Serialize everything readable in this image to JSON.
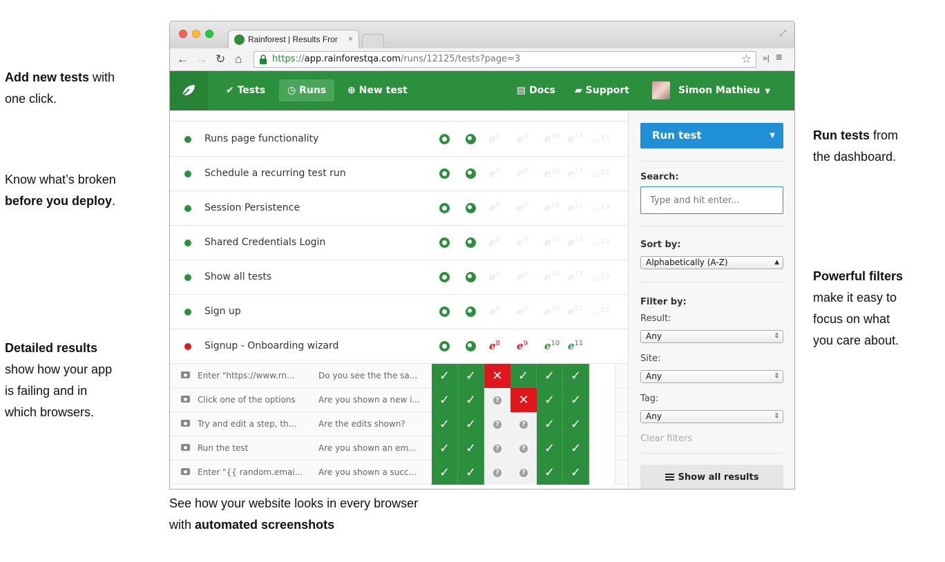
{
  "notes": {
    "left1_bold": "Add new tests",
    "left1_rest": " with",
    "left1_line2": "one click.",
    "left2_line1": "Know what’s broken",
    "left2_bold": "before you deploy",
    "left2_end": ".",
    "left3_bold": "Detailed results",
    "left3_line2": "show how your app",
    "left3_line3": "is failing and in",
    "left3_line4": "which browsers.",
    "right1_bold": "Run tests",
    "right1_rest": " from",
    "right1_line2": "the dashboard.",
    "right2_bold": "Powerful filters",
    "right2_line2": "make it easy to",
    "right2_line3": "focus on what",
    "right2_line4": "you care about.",
    "bottom_line1": "See how your website looks in every browser",
    "bottom_pre": "with ",
    "bottom_bold": "automated screenshots"
  },
  "browser": {
    "tab_title": "Rainforest | Results From R",
    "tab_close": "×",
    "url_scheme": "https",
    "url_sep": "://",
    "url_host": "app.rainforestqa.com",
    "url_path": "/runs/12125/tests?page=3",
    "ext_label": "»|",
    "menu_glyph": "≡"
  },
  "nav": {
    "tests": "Tests",
    "runs": "Runs",
    "new_test": "New test",
    "docs": "Docs",
    "support": "Support",
    "user": "Simon Mathieu"
  },
  "tests": [
    {
      "name": "Runs page functionality",
      "status": "pass"
    },
    {
      "name": "Schedule a recurring test run",
      "status": "pass"
    },
    {
      "name": "Session Persistence",
      "status": "pass"
    },
    {
      "name": "Shared Credentials Login",
      "status": "pass"
    },
    {
      "name": "Show all tests",
      "status": "pass"
    },
    {
      "name": "Sign up",
      "status": "pass"
    },
    {
      "name": "Signup - Onboarding wizard",
      "status": "fail"
    }
  ],
  "ie_versions": [
    "8",
    "9",
    "10",
    "11"
  ],
  "safari_version": "13",
  "steps": [
    {
      "action": "Enter \"https://www.rn...",
      "question": "Do you see the the sa...",
      "results": [
        "pass",
        "pass",
        "fail",
        "pass",
        "pass",
        "pass"
      ]
    },
    {
      "action": "Click one of the options",
      "question": "Are you shown a new i...",
      "results": [
        "pass",
        "pass",
        "unknown",
        "fail",
        "pass",
        "pass"
      ]
    },
    {
      "action": "Try and edit a step, th...",
      "question": "Are the edits shown?",
      "results": [
        "pass",
        "pass",
        "unknown",
        "unknown",
        "pass",
        "pass"
      ]
    },
    {
      "action": "Run the test",
      "question": "Are you shown an em...",
      "results": [
        "pass",
        "pass",
        "unknown",
        "unknown",
        "pass",
        "pass"
      ]
    },
    {
      "action": "Enter \"{{ random.emai...",
      "question": "Are you shown a succ...",
      "results": [
        "pass",
        "pass",
        "unknown",
        "unknown",
        "pass",
        "pass"
      ]
    }
  ],
  "sidebar": {
    "run_test": "Run test",
    "search_label": "Search:",
    "search_placeholder": "Type and hit enter...",
    "sort_label": "Sort by:",
    "sort_value": "Alphabetically (A-Z)",
    "filter_label": "Filter by:",
    "result_label": "Result:",
    "result_value": "Any",
    "site_label": "Site:",
    "site_value": "Any",
    "tag_label": "Tag:",
    "tag_value": "Any",
    "clear_filters": "Clear filters",
    "show_all": "Show all results"
  },
  "colors": {
    "brand_green": "#2b8f3d",
    "fail_red": "#e0161d",
    "primary_blue": "#1f8fd6"
  }
}
